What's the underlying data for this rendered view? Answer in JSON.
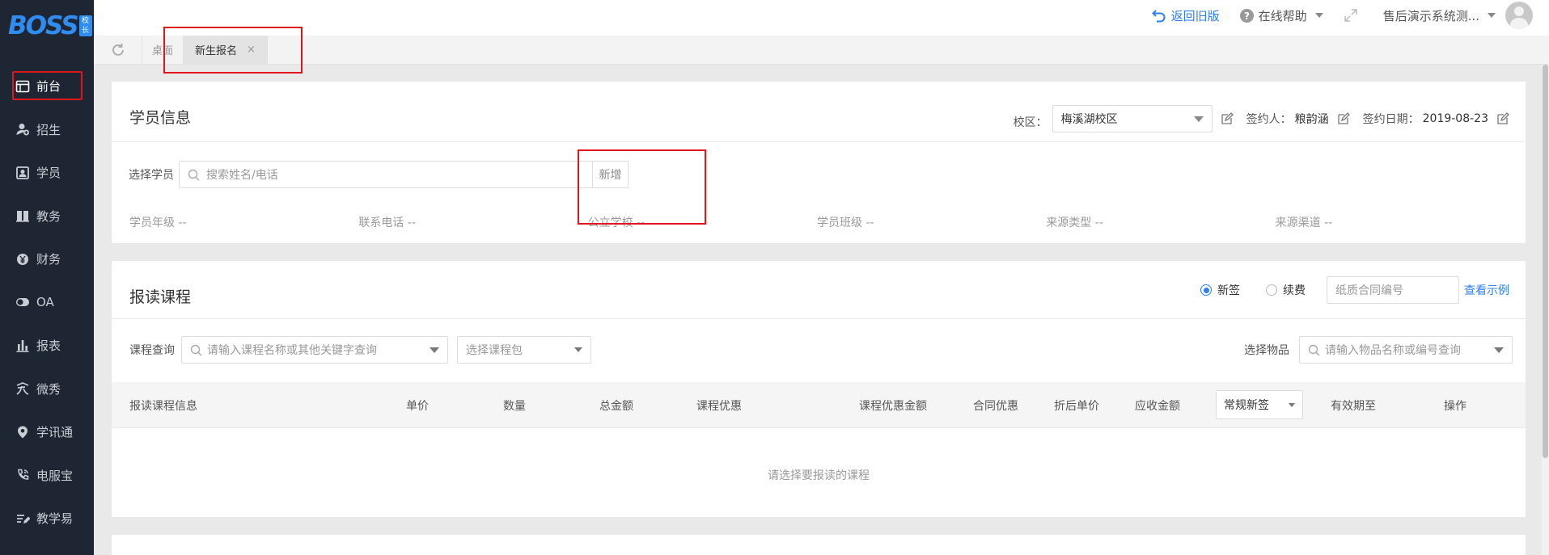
{
  "logo": {
    "text": "BOSS",
    "badge": "校长"
  },
  "sidebar": {
    "items": [
      {
        "label": "前台",
        "icon": "window-icon",
        "active": true
      },
      {
        "label": "招生",
        "icon": "user-add-icon"
      },
      {
        "label": "学员",
        "icon": "student-card-icon"
      },
      {
        "label": "教务",
        "icon": "book-icon"
      },
      {
        "label": "财务",
        "icon": "yen-icon"
      },
      {
        "label": "OA",
        "icon": "toggle-icon"
      },
      {
        "label": "报表",
        "icon": "bar-chart-icon"
      },
      {
        "label": "微秀",
        "icon": "xiu-icon"
      },
      {
        "label": "学讯通",
        "icon": "location-icon"
      },
      {
        "label": "电服宝",
        "icon": "phone-wave-icon"
      },
      {
        "label": "教学易",
        "icon": "pen-lines-icon"
      }
    ]
  },
  "topbar": {
    "back_old": "返回旧版",
    "help": "在线帮助",
    "user": "售后演示系统测..."
  },
  "tabs": [
    {
      "label": "桌面",
      "active": false
    },
    {
      "label": "新生报名",
      "active": true,
      "close": "×"
    }
  ],
  "student_info": {
    "title": "学员信息",
    "campus_label": "校区：",
    "campus_value": "梅溪湖校区",
    "signer_label": "签约人：",
    "signer_value": "粮韵涵",
    "date_label": "签约日期：",
    "date_value": "2019-08-23",
    "select_label": "选择学员",
    "search_placeholder": "搜索姓名/电话",
    "add_button": "新增",
    "fields": [
      "学员年级 --",
      "联系电话 --",
      "公立学校 --",
      "学员班级 --",
      "来源类型 --",
      "来源渠道 --"
    ]
  },
  "course": {
    "title": "报读课程",
    "radio_new": "新签",
    "radio_renew": "续费",
    "contract_placeholder": "纸质合同编号",
    "view_example": "查看示例",
    "query_label": "课程查询",
    "query_placeholder": "请输入课程名称或其他关键字查询",
    "package_placeholder": "选择课程包",
    "goods_label": "选择物品",
    "goods_placeholder": "请输入物品名称或编号查询",
    "columns": {
      "info": "报读课程信息",
      "price": "单价",
      "qty": "数量",
      "total": "总金额",
      "discount": "课程优惠",
      "discount_amount": "课程优惠金额",
      "contract_discount": "合同优惠",
      "net_price": "折后单价",
      "receivable": "应收金额",
      "sign_type": "常规新签",
      "valid_until": "有效期至",
      "action": "操作"
    },
    "empty_text": "请选择要报读的课程"
  },
  "colors": {
    "accent": "#2f7ff0",
    "sidebar_bg": "#1f2633",
    "highlight": "#e0161c"
  }
}
